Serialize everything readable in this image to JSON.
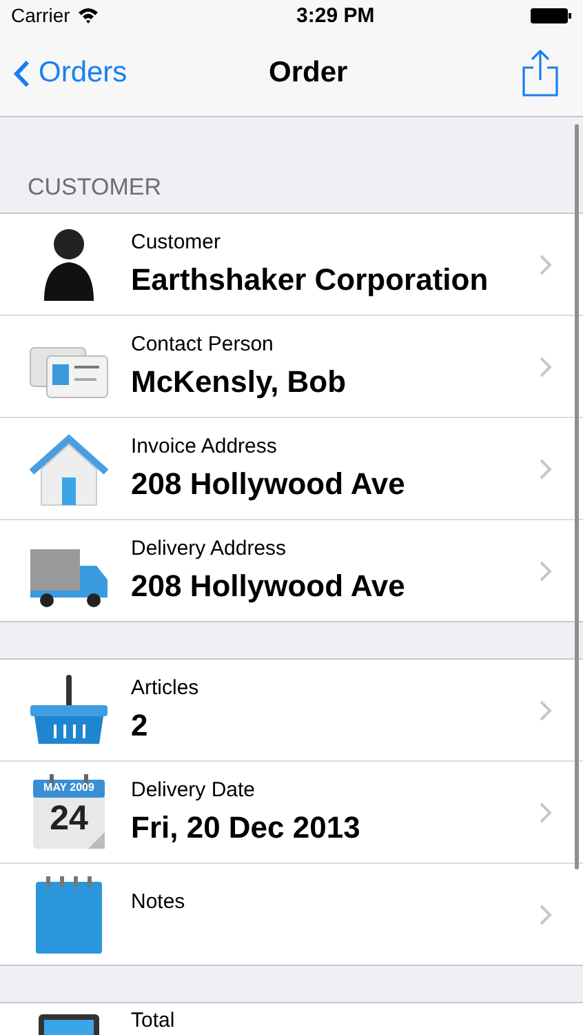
{
  "status_bar": {
    "carrier": "Carrier",
    "time": "3:29 PM"
  },
  "nav_bar": {
    "back": "Orders",
    "title": "Order"
  },
  "sections": [
    {
      "header": "CUSTOMER",
      "rows": [
        {
          "kind": "person",
          "label": "Customer",
          "value": "Earthshaker Corporation"
        },
        {
          "kind": "cards",
          "label": "Contact Person",
          "value": "McKensly, Bob"
        },
        {
          "kind": "house",
          "label": "Invoice Address",
          "value": "208 Hollywood Ave"
        },
        {
          "kind": "truck",
          "label": "Delivery Address",
          "value": "208 Hollywood Ave"
        }
      ]
    },
    {
      "rows": [
        {
          "kind": "basket",
          "label": "Articles",
          "value": "2"
        },
        {
          "kind": "calendar",
          "label": "Delivery Date",
          "value": "Fri, 20 Dec 2013",
          "icon_texts": [
            "MAY 2009",
            "24"
          ]
        },
        {
          "kind": "notepad",
          "label": "Notes"
        }
      ]
    },
    {
      "rows": [
        {
          "kind": "monitor",
          "label": "Total"
        }
      ]
    }
  ]
}
